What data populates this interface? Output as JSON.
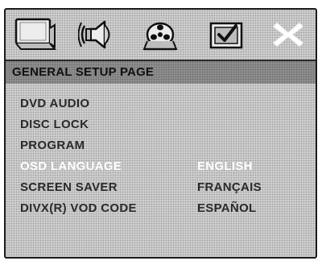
{
  "icons": [
    {
      "name": "general-setup-tv-icon",
      "active": true
    },
    {
      "name": "audio-speaker-icon",
      "active": false
    },
    {
      "name": "video-reel-icon",
      "active": false
    },
    {
      "name": "preference-check-icon",
      "active": false
    },
    {
      "name": "close-x-icon",
      "active": false
    }
  ],
  "header": {
    "title": "GENERAL SETUP PAGE"
  },
  "menu": {
    "items": [
      {
        "label": "DVD AUDIO"
      },
      {
        "label": "DISC LOCK"
      },
      {
        "label": "PROGRAM"
      },
      {
        "label": "OSD LANGUAGE",
        "selected": true
      },
      {
        "label": "SCREEN SAVER"
      },
      {
        "label": "DIVX(R) VOD CODE"
      }
    ]
  },
  "options": {
    "items": [
      {
        "label": "ENGLISH",
        "selected": true
      },
      {
        "label": "FRANÇAIS"
      },
      {
        "label": "ESPAÑOL"
      }
    ]
  },
  "colors": {
    "background": "#cfcfcf",
    "header_bar": "#8e8e8e",
    "text": "#2a2a2a",
    "highlight_text": "#ffffff"
  }
}
